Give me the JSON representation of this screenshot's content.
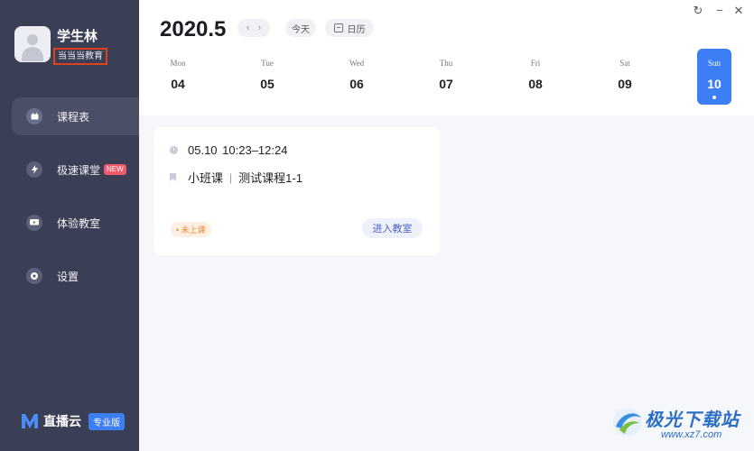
{
  "user": {
    "name": "学生林",
    "organization": "当当当教育"
  },
  "nav": {
    "items": [
      {
        "label": "课程表",
        "icon": "calendar-icon",
        "active": true
      },
      {
        "label": "极速课堂",
        "icon": "lightning-icon",
        "badge": "NEW"
      },
      {
        "label": "体验教室",
        "icon": "tv-icon"
      },
      {
        "label": "设置",
        "icon": "gear-icon"
      }
    ]
  },
  "brand": {
    "name": "直播云",
    "badge": "专业版"
  },
  "header": {
    "month": "2020.5",
    "prev_symbol": "‹",
    "next_symbol": "›",
    "today_label": "今天",
    "calendar_label": "日历"
  },
  "window": {
    "refresh": "↻",
    "minimize": "−",
    "close": "✕"
  },
  "week": [
    {
      "name": "Mon",
      "num": "04"
    },
    {
      "name": "Tue",
      "num": "05"
    },
    {
      "name": "Wed",
      "num": "06"
    },
    {
      "name": "Thu",
      "num": "07"
    },
    {
      "name": "Fri",
      "num": "08"
    },
    {
      "name": "Sat",
      "num": "09"
    },
    {
      "name": "Sun",
      "num": "10",
      "selected": true
    }
  ],
  "course": {
    "time": "05.10 10:23–12:24",
    "type": "小班课",
    "separator": "|",
    "name": "测试课程1-1",
    "status": "• 未上课",
    "enter_label": "进入教室"
  },
  "watermark": {
    "text": "极光下载站",
    "url": "www.xz7.com"
  },
  "colors": {
    "sidebar": "#3b3f55",
    "accent": "#3d7ef5",
    "badge": "#f05a6b",
    "status": "#f08a2c"
  }
}
